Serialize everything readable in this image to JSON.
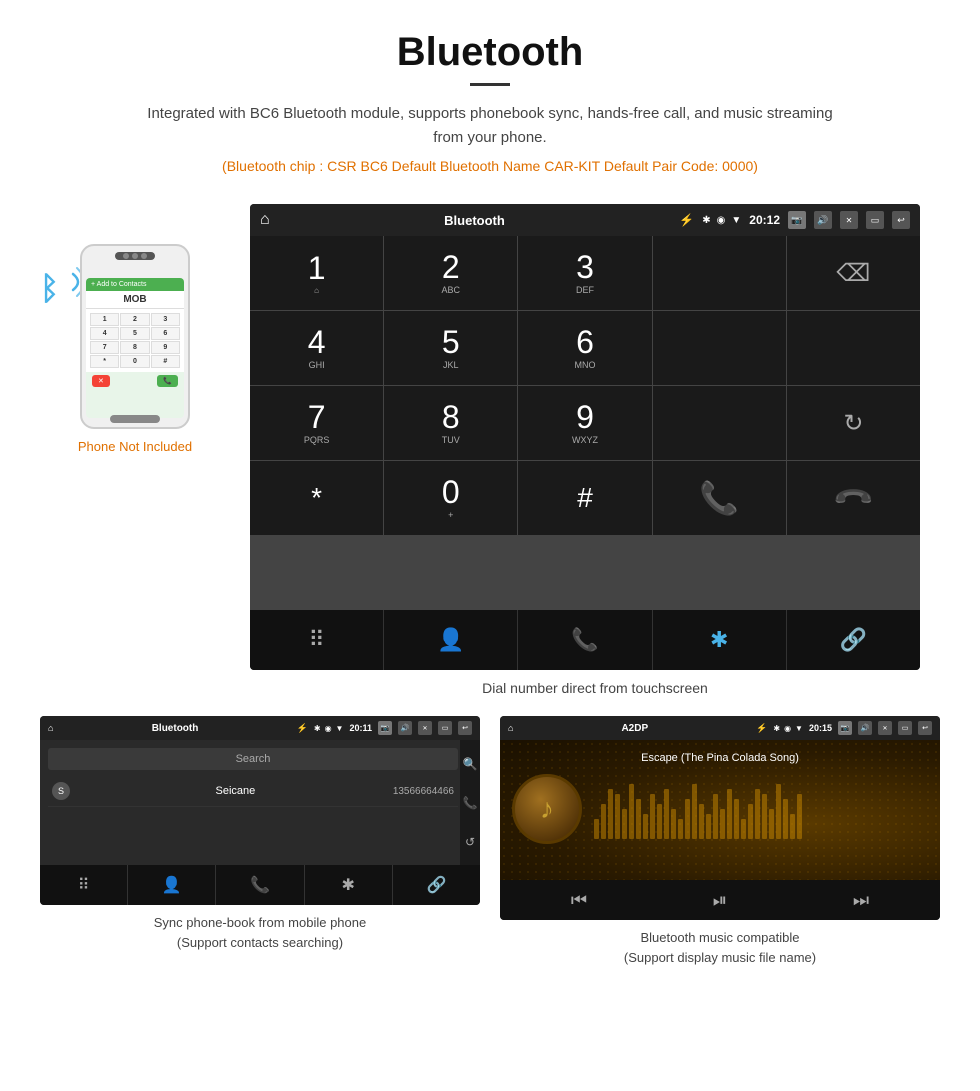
{
  "header": {
    "title": "Bluetooth",
    "divider": true,
    "description": "Integrated with BC6 Bluetooth module, supports phonebook sync, hands-free call, and music streaming from your phone.",
    "specs": "(Bluetooth chip : CSR BC6    Default Bluetooth Name CAR-KIT    Default Pair Code: 0000)"
  },
  "big_screen": {
    "statusbar": {
      "home_icon": "⌂",
      "title": "Bluetooth",
      "usb_icon": "⚡",
      "bt_icon": "✱",
      "location_icon": "◉",
      "wifi_icon": "▼",
      "time": "20:12",
      "camera_icon": "📷",
      "volume_icon": "🔊",
      "x_icon": "✕",
      "window_icon": "▭",
      "back_icon": "↩"
    },
    "dialpad": {
      "rows": [
        [
          {
            "num": "1",
            "letters": ""
          },
          {
            "num": "2",
            "letters": "ABC"
          },
          {
            "num": "3",
            "letters": "DEF"
          },
          {
            "num": "",
            "letters": "",
            "type": "empty"
          },
          {
            "num": "",
            "letters": "",
            "type": "backspace"
          }
        ],
        [
          {
            "num": "4",
            "letters": "GHI"
          },
          {
            "num": "5",
            "letters": "JKL"
          },
          {
            "num": "6",
            "letters": "MNO"
          },
          {
            "num": "",
            "letters": "",
            "type": "empty"
          },
          {
            "num": "",
            "letters": "",
            "type": "empty"
          }
        ],
        [
          {
            "num": "7",
            "letters": "PQRS"
          },
          {
            "num": "8",
            "letters": "TUV"
          },
          {
            "num": "9",
            "letters": "WXYZ"
          },
          {
            "num": "",
            "letters": "",
            "type": "empty"
          },
          {
            "num": "",
            "letters": "",
            "type": "reload"
          }
        ],
        [
          {
            "num": "*",
            "letters": ""
          },
          {
            "num": "0",
            "letters": "+"
          },
          {
            "num": "#",
            "letters": ""
          },
          {
            "num": "",
            "letters": "",
            "type": "call-green"
          },
          {
            "num": "",
            "letters": "",
            "type": "call-red"
          }
        ]
      ]
    },
    "toolbar": [
      "⠿",
      "👤",
      "📞",
      "✱",
      "🔗"
    ],
    "caption": "Dial number direct from touchscreen"
  },
  "phone_section": {
    "not_included": "Phone Not Included",
    "keypad_keys": [
      "1",
      "2",
      "3",
      "4",
      "5",
      "6",
      "7",
      "8",
      "9",
      "*",
      "0",
      "#"
    ]
  },
  "phonebook_screen": {
    "statusbar": {
      "home_icon": "⌂",
      "title": "Bluetooth",
      "usb_icon": "⚡",
      "bt_icon": "✱",
      "location_icon": "◉",
      "wifi_icon": "▼",
      "time": "20:11"
    },
    "search_placeholder": "Search",
    "contacts": [
      {
        "letter": "S",
        "name": "Seicane",
        "number": "13566664466"
      }
    ],
    "toolbar": [
      "⠿",
      "👤",
      "📞",
      "✱",
      "🔗"
    ],
    "sidebar_icons": [
      "🔍",
      "📞",
      "↺"
    ],
    "caption_line1": "Sync phone-book from mobile phone",
    "caption_line2": "(Support contacts searching)"
  },
  "music_screen": {
    "statusbar": {
      "home_icon": "⌂",
      "title": "A2DP",
      "usb_icon": "⚡",
      "bt_icon": "✱",
      "location_icon": "◉",
      "wifi_icon": "▼",
      "time": "20:15"
    },
    "song_title": "Escape (The Pina Colada Song)",
    "controls": [
      "⏮",
      "⏯",
      "⏭"
    ],
    "bar_heights": [
      20,
      35,
      50,
      45,
      30,
      55,
      40,
      25,
      45,
      35,
      50,
      30,
      20,
      40,
      55,
      35,
      25,
      45,
      30,
      50,
      40,
      20,
      35,
      50,
      45,
      30,
      55,
      40,
      25,
      45
    ],
    "caption_line1": "Bluetooth music compatible",
    "caption_line2": "(Support display music file name)"
  }
}
